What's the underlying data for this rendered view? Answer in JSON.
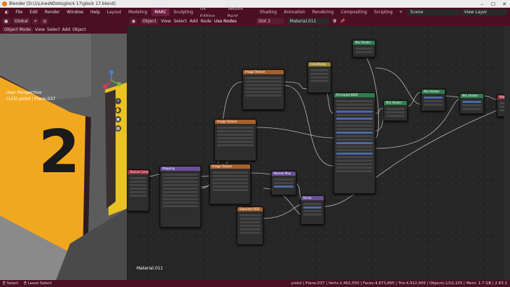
{
  "titlebar": {
    "title": "Blender [D:\\1\\LinesNDots\\glock 17\\glock 17.blend]"
  },
  "menu": [
    "File",
    "Edit",
    "Render",
    "Window",
    "Help"
  ],
  "workspaces": [
    "Layout",
    "Modeling",
    "MARC",
    "Sculpting",
    "UV Editing",
    "Texture Paint",
    "Shading",
    "Animation",
    "Rendering",
    "Compositing",
    "Scripting"
  ],
  "active_workspace": "MARC",
  "scene": "Scene",
  "view_layer": "View Layer",
  "viewport": {
    "orientation": "Global",
    "mode": "Object Mode",
    "view": "View",
    "select": "Select",
    "add": "Add",
    "object": "Object",
    "perspective": "User Perspective",
    "object_info": "(125) pistol | Plane.037",
    "sign_number": "2"
  },
  "node_editor": {
    "type": "Object",
    "view": "View",
    "select": "Select",
    "add": "Add",
    "node": "Node",
    "use_nodes": "Use Nodes",
    "slot": "Slot 2",
    "material": "Material.011",
    "material_label": "Material.011"
  },
  "nodes": [
    {
      "title": "Texture Coordinate",
      "color": "#a12e3c"
    },
    {
      "title": "Mapping",
      "color": "#6a4f9c"
    },
    {
      "title": "Image Texture",
      "color": "#a8602a"
    },
    {
      "title": "Image Texture",
      "color": "#a8602a"
    },
    {
      "title": "Image Texture",
      "color": "#a8602a"
    },
    {
      "title": "Separate RGB",
      "color": "#a8602a"
    },
    {
      "title": "Normal Map",
      "color": "#6a4f9c"
    },
    {
      "title": "Bump",
      "color": "#6a4f9c"
    },
    {
      "title": "ColorRamp",
      "color": "#9a8a2a"
    },
    {
      "title": "Principled BSDF",
      "color": "#2e7d4f"
    },
    {
      "title": "Mix Shader",
      "color": "#2e7d4f"
    },
    {
      "title": "Mix Shader",
      "color": "#2e7d4f"
    },
    {
      "title": "Mix Shader",
      "color": "#2e7d4f"
    },
    {
      "title": "Material Output",
      "color": "#a12e3c"
    }
  ],
  "status": {
    "select": "Select",
    "lasso": "Lasso Select",
    "stats": "pistol | Plane.037 | Verts:2,462,550 | Faces:4,873,895 | Tris:4,922,956 | Objects:1/10,155 | Mem: 1.7 GB | 2.83.2"
  },
  "colors": {
    "accent": "#4b0f24",
    "sign": "#f2a81e"
  }
}
